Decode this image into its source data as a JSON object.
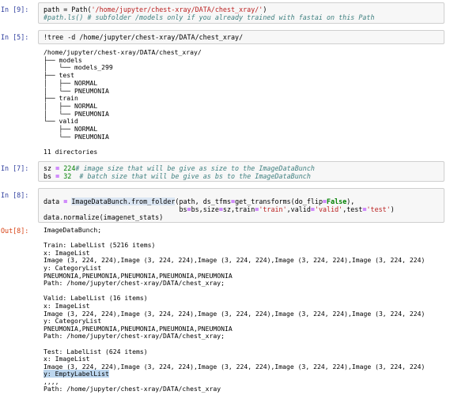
{
  "cells": {
    "c9": {
      "prompt": "In [9]:",
      "line1": {
        "a": "path = Path(",
        "s": "'/home/jupyter/chest-xray/DATA/chest_xray/'",
        "b": ")"
      },
      "line2": "#path.ls() # subfolder /models only if you already trained with fastai on this Path"
    },
    "c5": {
      "prompt": "In [5]:",
      "code": "!tree -d /home/jupyter/chest-xray/DATA/chest_xray/",
      "output": "/home/jupyter/chest-xray/DATA/chest_xray/\n├── models\n│   └── models_299\n├── test\n│   ├── NORMAL\n│   └── PNEUMONIA\n├── train\n│   ├── NORMAL\n│   └── PNEUMONIA\n└── valid\n    ├── NORMAL\n    └── PNEUMONIA\n\n11 directories"
    },
    "c7": {
      "prompt": "In [7]:",
      "line1": {
        "a": "sz ",
        "op": "=",
        "sp": " ",
        "num": "224",
        "cm": "# image size that will be give as size to the ImageDataBunch"
      },
      "line2": {
        "a": "bs ",
        "op": "=",
        "sp": " ",
        "num": "32",
        "gap": "  ",
        "cm": "# batch size that will be give as bs to the ImageDataBunch"
      }
    },
    "c8": {
      "prompt": "In [8]:",
      "line1": {
        "a": "data ",
        "op": "=",
        "sp": " ",
        "fn": "ImageDataBunch.from_folder",
        "b": "(path, ds_tfms",
        "op2": "=",
        "c": "get_transforms(do_flip",
        "op3": "=",
        "kw": "False",
        "d": "),"
      },
      "line2": {
        "pad": "                                  ",
        "a": "bs",
        "op": "=",
        "b": "bs,size",
        "op2": "=",
        "c": "sz,train",
        "op3": "=",
        "s1": "'train'",
        "d": ",valid",
        "op4": "=",
        "s2": "'valid'",
        "e": ",test",
        "op5": "=",
        "s3": "'test'",
        "f": ")"
      },
      "line3": "data.normalize(imagenet_stats)",
      "out_prompt": "Out[8]:",
      "output_main": "ImageDataBunch;\n\nTrain: LabelList (5216 items)\nx: ImageList\nImage (3, 224, 224),Image (3, 224, 224),Image (3, 224, 224),Image (3, 224, 224),Image (3, 224, 224)\ny: CategoryList\nPNEUMONIA,PNEUMONIA,PNEUMONIA,PNEUMONIA,PNEUMONIA\nPath: /home/jupyter/chest-xray/DATA/chest_xray;\n\nValid: LabelList (16 items)\nx: ImageList\nImage (3, 224, 224),Image (3, 224, 224),Image (3, 224, 224),Image (3, 224, 224),Image (3, 224, 224)\ny: CategoryList\nPNEUMONIA,PNEUMONIA,PNEUMONIA,PNEUMONIA,PNEUMONIA\nPath: /home/jupyter/chest-xray/DATA/chest_xray;\n\nTest: LabelList (624 items)\nx: ImageList\nImage (3, 224, 224),Image (3, 224, 224),Image (3, 224, 224),Image (3, 224, 224),Image (3, 224, 224)",
      "output_highlight": "y: EmptyLabelList",
      "output_tail": ",,,,\nPath: /home/jupyter/chest-xray/DATA/chest_xray"
    }
  },
  "colors": {
    "prompt_in": "#303f9f",
    "prompt_out": "#d84315",
    "string": "#ba2121",
    "comment": "#408080",
    "keyword": "#008000",
    "highlight": "#bcd6ee"
  }
}
